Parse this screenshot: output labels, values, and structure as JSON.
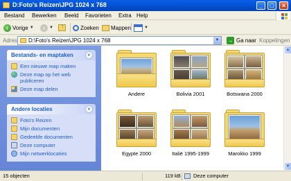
{
  "window": {
    "title": "D:Foto's Reizen\\JPG 1024 x 768"
  },
  "menu": [
    {
      "label": "Bestand"
    },
    {
      "label": "Bewerken"
    },
    {
      "label": "Beeld"
    },
    {
      "label": "Favorieten"
    },
    {
      "label": "Extra"
    },
    {
      "label": "Help"
    }
  ],
  "toolbar": {
    "back_label": "Vorige",
    "search_label": "Zoeken",
    "folders_label": "Mappen"
  },
  "address": {
    "label": "Adres",
    "value": "D:\\Foto's Reizen\\JPG 1024 x 768",
    "go_label": "Ga naar",
    "links_label": "Koppelingen"
  },
  "tasks": {
    "title": "Bestands- en maptaken",
    "items": [
      {
        "label": "Een nieuwe map maken",
        "icon": "new-folder-icon"
      },
      {
        "label": "Deze map op het web publiceren",
        "icon": "globe-icon"
      },
      {
        "label": "Deze map delen",
        "icon": "share-folder-icon"
      }
    ]
  },
  "locations": {
    "title": "Andere locaties",
    "items": [
      {
        "label": "Foto's Reizen",
        "icon": "folder-icon"
      },
      {
        "label": "Mijn documenten",
        "icon": "folder-icon"
      },
      {
        "label": "Gedeelde documenten",
        "icon": "folder-icon"
      },
      {
        "label": "Deze computer",
        "icon": "computer-icon"
      },
      {
        "label": "Mijn netwerklocaties",
        "icon": "network-icon"
      }
    ]
  },
  "folders": [
    {
      "name": "Andere"
    },
    {
      "name": "Bolivia 2001"
    },
    {
      "name": "Botswana 2000"
    },
    {
      "name": "Egypte 2000"
    },
    {
      "name": "Italië 1995-1999"
    },
    {
      "name": "Marokko 1999"
    }
  ],
  "status": {
    "objects": "15 objecten",
    "size": "119 kB",
    "location": "Deze computer"
  }
}
